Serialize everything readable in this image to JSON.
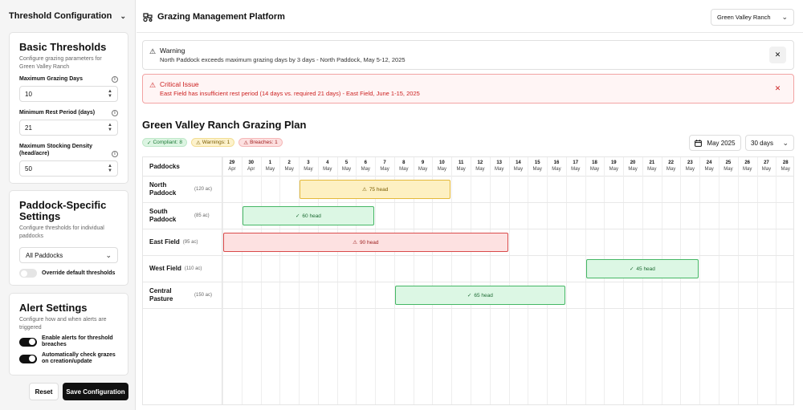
{
  "sidebar": {
    "title": "Threshold Configuration",
    "basic": {
      "heading": "Basic Thresholds",
      "description": "Configure grazing parameters for Green Valley Ranch",
      "max_days_label": "Maximum Grazing Days",
      "max_days_value": "10",
      "min_rest_label": "Minimum Rest Period (days)",
      "min_rest_value": "21",
      "max_density_label": "Maximum Stocking Density (head/acre)",
      "max_density_value": "50"
    },
    "paddock": {
      "heading": "Paddock-Specific Settings",
      "description": "Configure thresholds for individual paddocks",
      "select_value": "All Paddocks",
      "override_label": "Override default thresholds",
      "override_on": false
    },
    "alerts": {
      "heading": "Alert Settings",
      "description": "Configure how and when alerts are triggered",
      "enable_label": "Enable alerts for threshold breaches",
      "enable_on": true,
      "auto_label": "Automatically check grazes on creation/update",
      "auto_on": true
    },
    "reset_label": "Reset",
    "save_label": "Save Configuration"
  },
  "topbar": {
    "title": "Grazing Management Platform",
    "ranch": "Green Valley Ranch"
  },
  "alerts": {
    "warning": {
      "title": "Warning",
      "message": "North Paddock exceeds maximum grazing days by 3 days - North Paddock, May 5-12, 2025"
    },
    "critical": {
      "title": "Critical Issue",
      "message": "East Field has insufficient rest period (14 days vs. required 21 days) - East Field, June 1-15, 2025"
    }
  },
  "plan": {
    "title": "Green Valley Ranch Grazing Plan",
    "badges": {
      "compliant": "Compliant: 8",
      "warnings": "Warnings: 1",
      "breaches": "Breaches: 1"
    },
    "month": "May 2025",
    "range": "30 days",
    "paddocks_header": "Paddocks",
    "days": [
      {
        "d": "29",
        "m": "Apr"
      },
      {
        "d": "30",
        "m": "Apr"
      },
      {
        "d": "1",
        "m": "May"
      },
      {
        "d": "2",
        "m": "May"
      },
      {
        "d": "3",
        "m": "May"
      },
      {
        "d": "4",
        "m": "May"
      },
      {
        "d": "5",
        "m": "May"
      },
      {
        "d": "6",
        "m": "May"
      },
      {
        "d": "7",
        "m": "May"
      },
      {
        "d": "8",
        "m": "May"
      },
      {
        "d": "9",
        "m": "May"
      },
      {
        "d": "10",
        "m": "May"
      },
      {
        "d": "11",
        "m": "May"
      },
      {
        "d": "12",
        "m": "May"
      },
      {
        "d": "13",
        "m": "May"
      },
      {
        "d": "14",
        "m": "May"
      },
      {
        "d": "15",
        "m": "May"
      },
      {
        "d": "16",
        "m": "May"
      },
      {
        "d": "17",
        "m": "May"
      },
      {
        "d": "18",
        "m": "May"
      },
      {
        "d": "19",
        "m": "May"
      },
      {
        "d": "20",
        "m": "May"
      },
      {
        "d": "21",
        "m": "May"
      },
      {
        "d": "22",
        "m": "May"
      },
      {
        "d": "23",
        "m": "May"
      },
      {
        "d": "24",
        "m": "May"
      },
      {
        "d": "25",
        "m": "May"
      },
      {
        "d": "26",
        "m": "May"
      },
      {
        "d": "27",
        "m": "May"
      },
      {
        "d": "28",
        "m": "May"
      }
    ],
    "rows": [
      {
        "name": "North Paddock",
        "acres": "(120 ac)",
        "bar": {
          "label": "75 head",
          "status": "warning",
          "start": 4,
          "span": 8
        }
      },
      {
        "name": "South Paddock",
        "acres": "(85 ac)",
        "bar": {
          "label": "60 head",
          "status": "ok",
          "start": 1,
          "span": 7
        }
      },
      {
        "name": "East Field",
        "acres": "(95 ac)",
        "bar": {
          "label": "90 head",
          "status": "breach",
          "start": 0,
          "span": 15
        }
      },
      {
        "name": "West Field",
        "acres": "(110 ac)",
        "bar": {
          "label": "45 head",
          "status": "ok",
          "start": 19,
          "span": 6
        }
      },
      {
        "name": "Central Pasture",
        "acres": "(150 ac)",
        "bar": {
          "label": "65 head",
          "status": "ok",
          "start": 9,
          "span": 9
        }
      }
    ]
  },
  "colors": {
    "ok": "#45b765",
    "warning": "#e4b93a",
    "breach": "#d94a4a"
  }
}
